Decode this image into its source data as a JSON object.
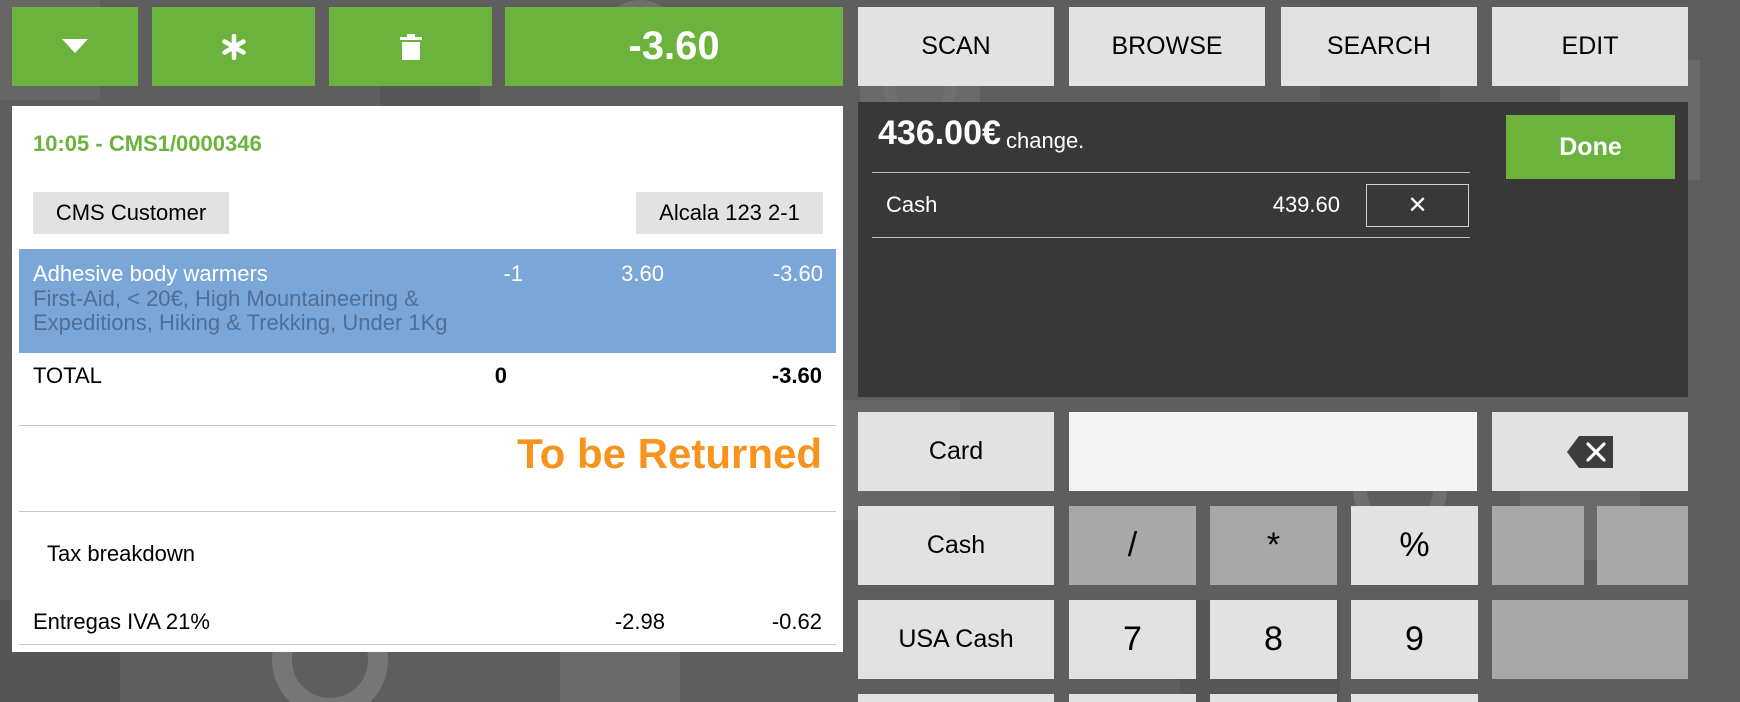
{
  "toolbar": {
    "total": "-3.60",
    "buttons": [
      "SCAN",
      "BROWSE",
      "SEARCH",
      "EDIT"
    ]
  },
  "receipt": {
    "header": "10:05 - CMS1/0000346",
    "customer": "CMS Customer",
    "address": "Alcala 123 2-1",
    "line": {
      "name": "Adhesive body warmers",
      "categories_1": "First-Aid, < 20€, High Mountaineering &",
      "categories_2": "Expeditions, Hiking & Trekking, Under 1Kg",
      "qty": "-1",
      "price": "3.60",
      "amount": "-3.60"
    },
    "total_label": "TOTAL",
    "total_qty": "0",
    "total_amount": "-3.60",
    "status": "To be Returned",
    "tax_title": "Tax breakdown",
    "tax": {
      "label": "Entregas IVA 21%",
      "base": "-2.98",
      "amount": "-0.62"
    }
  },
  "payment": {
    "change_amount": "436.00€",
    "change_label": "change.",
    "done_label": "Done",
    "method": "Cash",
    "method_amount": "439.60",
    "remove_symbol": "✕"
  },
  "keypad": {
    "methods": [
      "Card",
      "Cash",
      "USA Cash"
    ],
    "ops": [
      "/",
      "*",
      "%"
    ],
    "digits": [
      "7",
      "8",
      "9"
    ],
    "input_value": "",
    "backspace_icon": "backspace-icon"
  },
  "colors": {
    "accent": "#6cb33e",
    "selected_row": "#7aa7d8",
    "status": "#f7941d",
    "panel": "#383838",
    "background": "#5e5e5e"
  }
}
